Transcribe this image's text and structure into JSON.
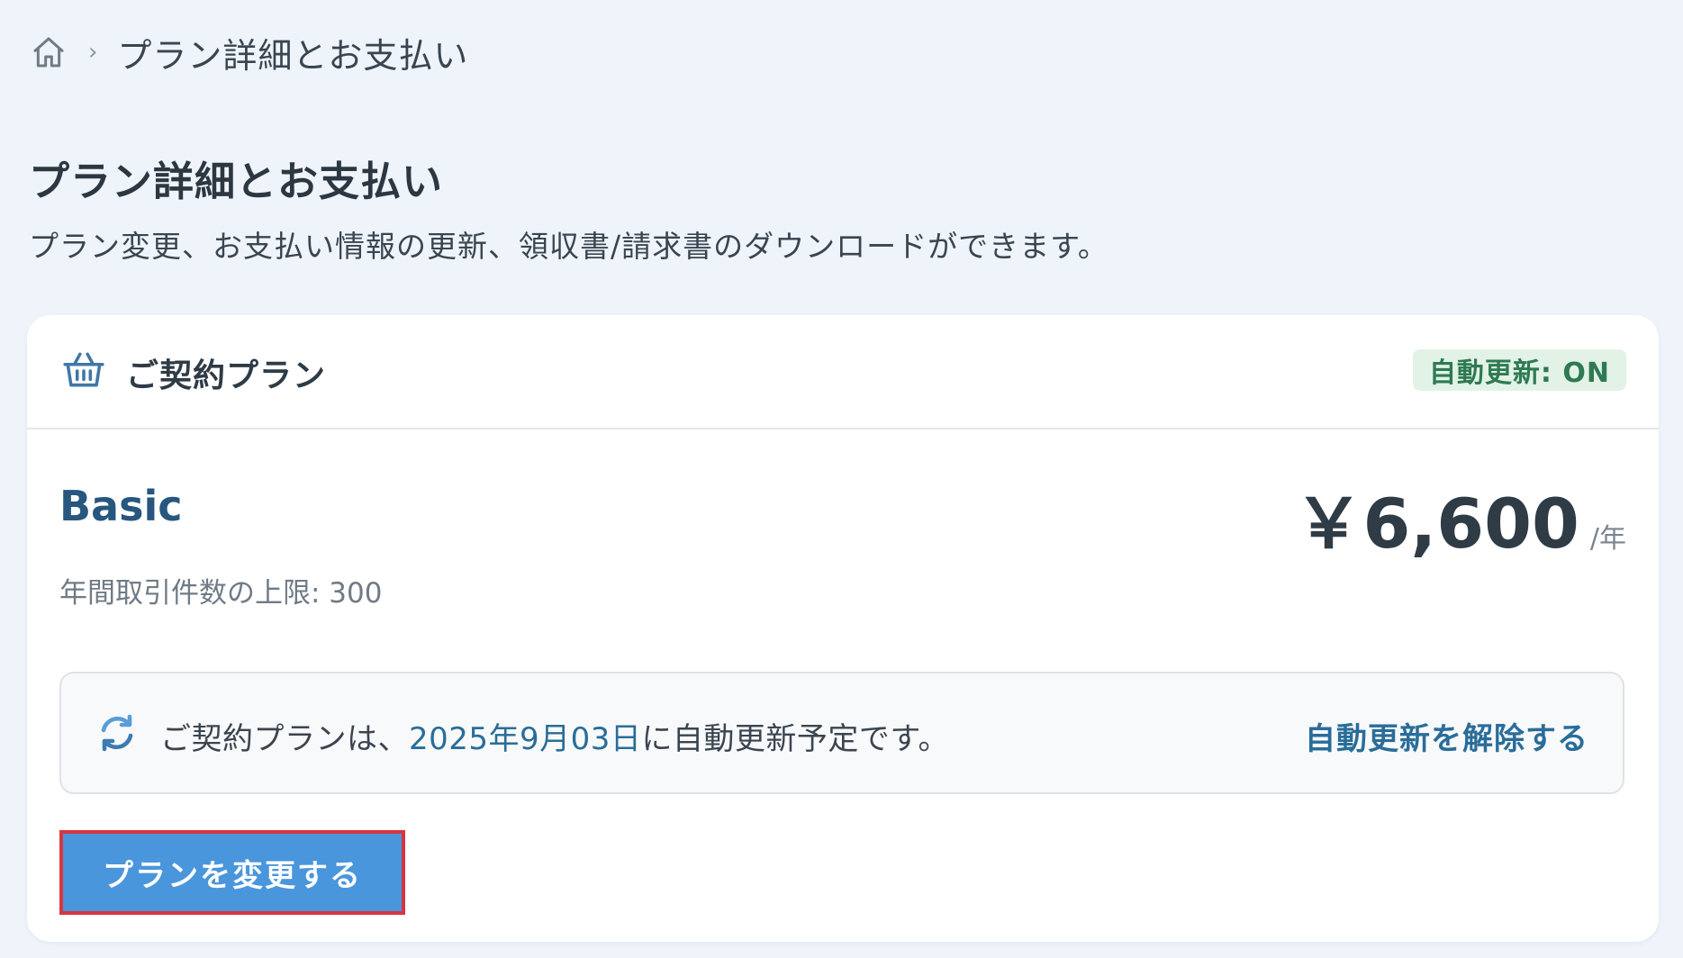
{
  "breadcrumb": {
    "home_icon": "home-icon",
    "separator": "›",
    "current": "プラン詳細とお支払い"
  },
  "page": {
    "title": "プラン詳細とお支払い",
    "subtitle": "プラン変更、お支払い情報の更新、領収書/請求書のダウンロードができます。"
  },
  "card": {
    "header_icon": "basket-icon",
    "header_title": "ご契約プラン",
    "badge": "自動更新: ON",
    "plan": {
      "name": "Basic",
      "limit": "年間取引件数の上限: 300",
      "price": "￥6,600",
      "price_unit": "/年"
    },
    "renewal": {
      "icon": "refresh-icon",
      "prefix": "ご契約プランは、",
      "date": "2025年9月03日",
      "suffix": "に自動更新予定です。",
      "cancel_link": "自動更新を解除する"
    },
    "change_button": "プランを変更する"
  },
  "colors": {
    "background": "#eff4fb",
    "accent": "#2a6d99",
    "plan_name": "#27567f",
    "badge_bg": "#e2f2e7",
    "badge_text": "#2f7a52",
    "button_bg": "#4a96dc",
    "highlight_border": "#d8353f"
  }
}
